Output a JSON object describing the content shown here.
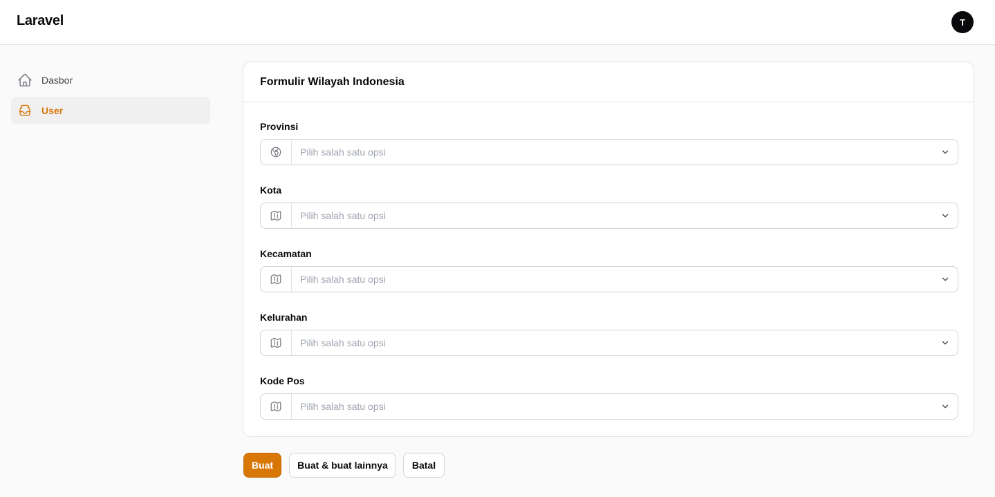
{
  "app": {
    "brand": "Laravel",
    "avatar_initial": "T"
  },
  "sidebar": {
    "items": [
      {
        "label": "Dasbor",
        "icon": "home-icon",
        "active": false
      },
      {
        "label": "User",
        "icon": "inbox-stack-icon",
        "active": true
      }
    ]
  },
  "form": {
    "title": "Formulir Wilayah Indonesia",
    "fields": [
      {
        "label": "Provinsi",
        "placeholder": "Pilih salah satu opsi",
        "icon": "globe-icon"
      },
      {
        "label": "Kota",
        "placeholder": "Pilih salah satu opsi",
        "icon": "map-icon"
      },
      {
        "label": "Kecamatan",
        "placeholder": "Pilih salah satu opsi",
        "icon": "map-icon"
      },
      {
        "label": "Kelurahan",
        "placeholder": "Pilih salah satu opsi",
        "icon": "map-icon"
      },
      {
        "label": "Kode Pos",
        "placeholder": "Pilih salah satu opsi",
        "icon": "map-icon"
      }
    ]
  },
  "actions": {
    "create": "Buat",
    "create_another": "Buat & buat lainnya",
    "cancel": "Batal"
  },
  "colors": {
    "accent": "#d97706",
    "text": "#09090b",
    "muted": "#9ca3af",
    "border": "#e4e4e7"
  }
}
